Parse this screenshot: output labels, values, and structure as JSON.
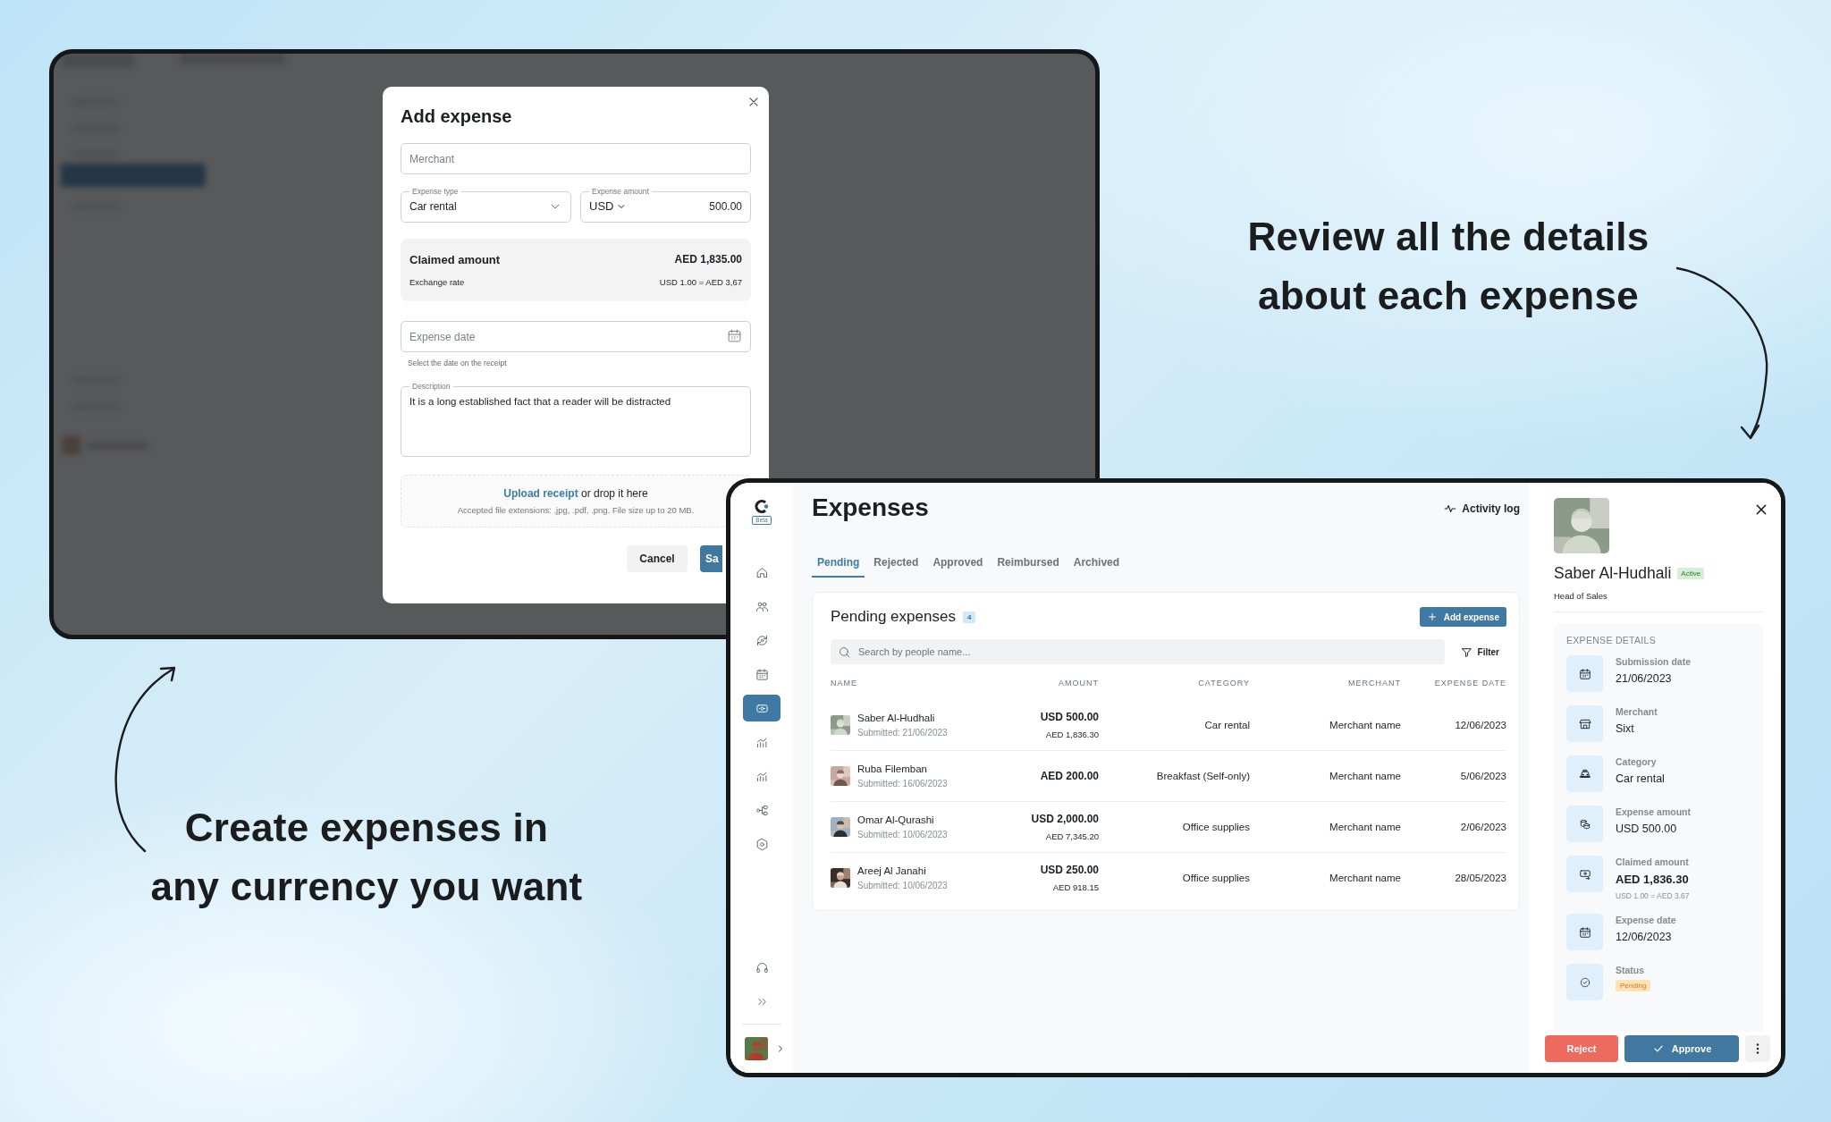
{
  "headlines": [
    {
      "text": "Review all the details\nabout each expense"
    },
    {
      "text": "Create expenses in\nany currency you want"
    }
  ],
  "dialog": {
    "title": "Add expense",
    "merchant": {
      "placeholder": "Merchant"
    },
    "expense_type": {
      "label": "Expense type",
      "value": "Car rental"
    },
    "expense_amount": {
      "label": "Expense amount",
      "currency": "USD",
      "value": "500.00"
    },
    "claimed": {
      "label": "Claimed amount",
      "value": "AED 1,835.00",
      "rate_label": "Exchange rate",
      "rate": "USD 1.00 = AED 3,67"
    },
    "expense_date": {
      "placeholder": "Expense date",
      "hint": "Select the date on the receipt"
    },
    "description": {
      "label": "Description",
      "value": "It is a long established fact that a reader will be distracted"
    },
    "upload": {
      "link": "Upload receipt",
      "text": "or drop it here",
      "note": "Accepted file extensions: .jpg, .pdf, .png. File size up to 20 MB."
    },
    "buttons": {
      "cancel": "Cancel",
      "save": "Sa"
    }
  },
  "app": {
    "sidebar": {
      "logo_badge": "Beta",
      "nav": [
        {
          "kind": "home",
          "selected": false
        },
        {
          "kind": "people",
          "selected": false
        },
        {
          "kind": "sync",
          "selected": false
        },
        {
          "kind": "calendar",
          "selected": false
        },
        {
          "kind": "expenses",
          "selected": true
        },
        {
          "kind": "chart",
          "selected": false
        },
        {
          "kind": "chart",
          "selected": false
        },
        {
          "kind": "org",
          "selected": false
        },
        {
          "kind": "settings",
          "selected": false
        }
      ],
      "bottom": [
        {
          "kind": "support"
        },
        {
          "kind": "expand"
        }
      ]
    },
    "title": "Expenses",
    "activity_log": "Activity log",
    "tabs": [
      {
        "label": "Pending",
        "selected": true
      },
      {
        "label": "Rejected",
        "selected": false
      },
      {
        "label": "Approved",
        "selected": false
      },
      {
        "label": "Reimbursed",
        "selected": false
      },
      {
        "label": "Archived",
        "selected": false
      }
    ],
    "card": {
      "title": "Pending expenses",
      "count": "4",
      "add_button": "Add expense",
      "search": {
        "placeholder": "Search by people name..."
      },
      "filter": "Filter",
      "columns": [
        "NAME",
        "AMOUNT",
        "CATEGORY",
        "MERCHANT",
        "EXPENSE DATE"
      ],
      "rows": [
        {
          "name": "Saber Al-Hudhali",
          "submitted": "Submitted: 21/06/2023",
          "amount": "USD 500.00",
          "converted": "AED 1,836.30",
          "category": "Car rental",
          "merchant": "Merchant name",
          "date": "12/06/2023"
        },
        {
          "name": "Ruba Filemban",
          "submitted": "Submitted: 16/06/2023",
          "amount": "AED 200.00",
          "category": "Breakfast (Self-only)",
          "merchant": "Merchant name",
          "date": "5/06/2023"
        },
        {
          "name": "Omar Al-Qurashi",
          "submitted": "Submitted: 10/06/2023",
          "amount": "USD 2,000.00",
          "converted": "AED 7,345.20",
          "category": "Office supplies",
          "merchant": "Merchant name",
          "date": "2/06/2023"
        },
        {
          "name": "Areej Al Janahi",
          "submitted": "Submitted: 10/06/2023",
          "amount": "USD 250.00",
          "converted": "AED 918.15",
          "category": "Office supplies",
          "merchant": "Merchant name",
          "date": "28/05/2023"
        }
      ]
    },
    "detail": {
      "name": "Saber Al-Hudhali",
      "status": "Active",
      "role": "Head of Sales",
      "section": "EXPENSE DETAILS",
      "items": [
        {
          "kind": "calendar",
          "label": "Submission date",
          "value": "21/06/2023"
        },
        {
          "kind": "store",
          "label": "Merchant",
          "value": "Sixt"
        },
        {
          "kind": "car",
          "label": "Category",
          "value": "Car rental"
        },
        {
          "kind": "coins",
          "label": "Expense amount",
          "value": "USD 500.00"
        },
        {
          "kind": "exchange",
          "label": "Claimed amount",
          "value": "AED 1,836.30",
          "emphasis": true,
          "note": "USD 1.00 = AED 3.67"
        },
        {
          "kind": "calendar",
          "label": "Expense date",
          "value": "12/06/2023"
        },
        {
          "kind": "status",
          "label": "Status",
          "badge": "Pending"
        }
      ],
      "reject": "Reject",
      "approve": "Approve"
    }
  }
}
